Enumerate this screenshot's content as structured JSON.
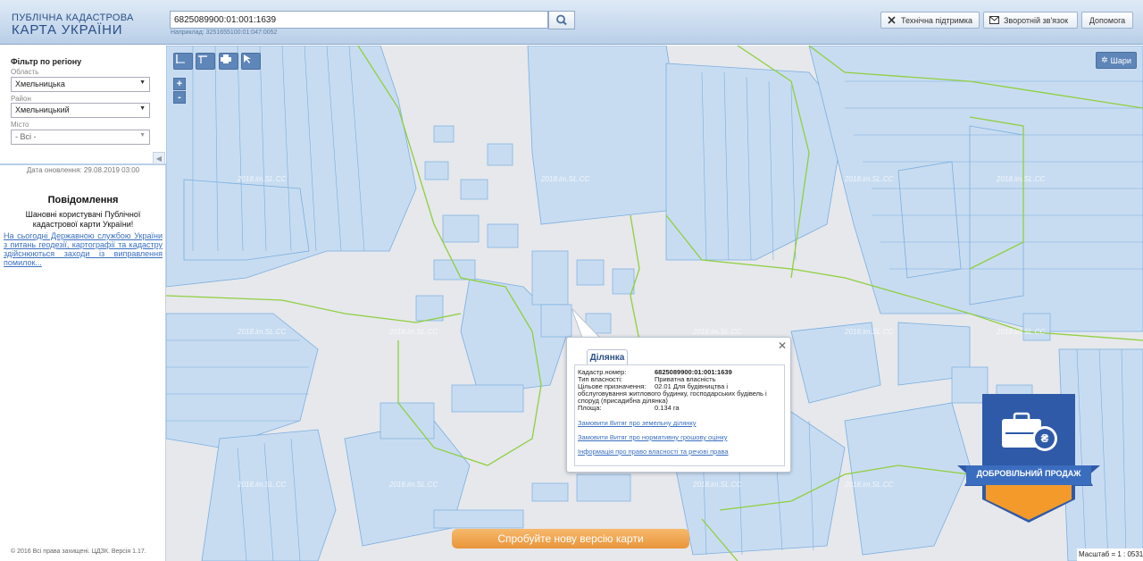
{
  "header": {
    "logo_line1": "ПУБЛІЧНА КАДАСТРОВА",
    "logo_line2": "КАРТА УКРАЇНИ",
    "search_value": "6825089900:01:001:1639",
    "search_hint": "Наприклад: 3251655100:01:047:0052",
    "buttons": [
      {
        "label": "Технічна підтримка",
        "icon": "wrench-icon"
      },
      {
        "label": "Зворотній зв'язок",
        "icon": "envelope-icon"
      },
      {
        "label": "Допомога"
      }
    ]
  },
  "sidebar": {
    "filter_title": "Фільтр по регіону",
    "oblast_label": "Область",
    "oblast_value": "Хмельницька",
    "raion_label": "Район",
    "raion_value": "Хмельницький",
    "misto_label": "Місто",
    "misto_value": "- Всі -",
    "update_date": "Дата оновлення: 29.08.2019 03:00",
    "notice_title": "Повідомлення",
    "notice_body": "Шановні користувачі Публічної кадастрової карти України!",
    "notice_link": "На сьогодні Державною службою України з питань геодезії, картографії та кадастру здійснюються заходи із виправлення помилок...",
    "copyright": "© 2016 Всі права захищені. ЦДЗК. Версія 1.17."
  },
  "map": {
    "layers_label": "Шари",
    "zoom_in": "+",
    "zoom_out": "-",
    "watermark": "2018.im.SL.CC",
    "try_new": "Спробуйте нову версію карти",
    "scale": "Масштаб = 1 : 0531"
  },
  "popup": {
    "tab": "Ділянка",
    "rows": [
      {
        "label": "Кадастр.номер:",
        "value": "6825089900:01:001:1639"
      },
      {
        "label": "Тип власності:",
        "value": "Приватна власність"
      },
      {
        "label": "Цільове призначення:",
        "value": "02.01 Для будівництва і"
      },
      {
        "label": "",
        "value": "обслуговування житлового будинку, господарських будівель і"
      },
      {
        "label": "",
        "value": "споруд (присадибна ділянка)"
      },
      {
        "label": "Площа:",
        "value": "0.134 га"
      }
    ],
    "links": [
      "Замовити Витяг про земельну ділянку",
      "Замовити Витяг про нормативну грошову оцінку",
      "Інформація про право власності та речові права"
    ]
  },
  "badge": {
    "label": "ДОБРОВІЛЬНИЙ ПРОДАЖ",
    "currency": "₴"
  },
  "colors": {
    "parcel_fill": "#c8dcf1",
    "parcel_stroke": "#6aa0d8",
    "boundary": "#8fcf3e",
    "badge_blue": "#2e5aa8",
    "badge_orange": "#f39a2b"
  }
}
